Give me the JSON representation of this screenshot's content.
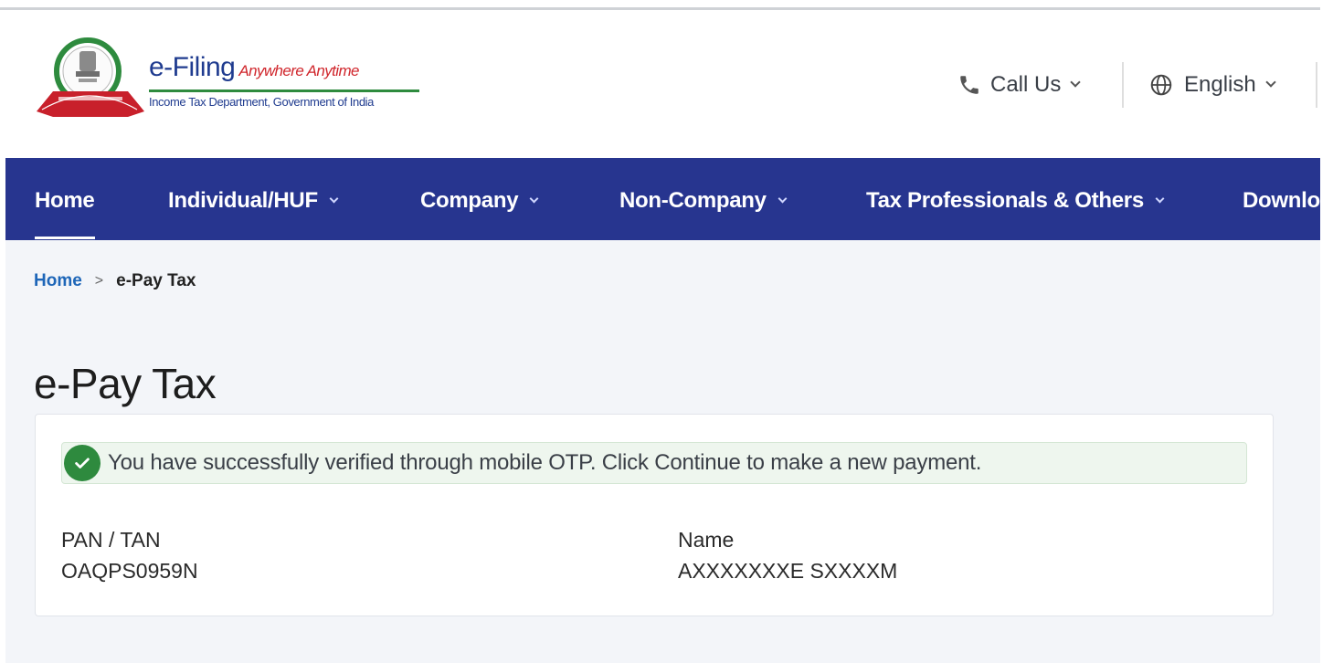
{
  "header": {
    "brand_title": "e-Filing",
    "brand_tagline": "Anywhere Anytime",
    "brand_subtitle": "Income Tax Department, Government of India",
    "call_us": "Call Us",
    "language": "English"
  },
  "nav": {
    "items": [
      {
        "label": "Home"
      },
      {
        "label": "Individual/HUF"
      },
      {
        "label": "Company"
      },
      {
        "label": "Non-Company"
      },
      {
        "label": "Tax Professionals & Others"
      },
      {
        "label": "Downlo"
      }
    ]
  },
  "breadcrumb": {
    "home": "Home",
    "separator": ">",
    "current": "e-Pay Tax"
  },
  "page": {
    "title": "e-Pay Tax",
    "alert": "You have successfully verified through mobile OTP. Click Continue to make a new payment.",
    "fields": [
      {
        "label": "PAN / TAN",
        "value": "OAQPS0959N"
      },
      {
        "label": "Name",
        "value": "AXXXXXXXE SXXXXM"
      }
    ]
  },
  "colors": {
    "nav_bg": "#27358f",
    "brand_blue": "#1f3b8f",
    "tagline_red": "#d0262c",
    "success_green": "#2e8a3e",
    "link_blue": "#1e66b8"
  }
}
